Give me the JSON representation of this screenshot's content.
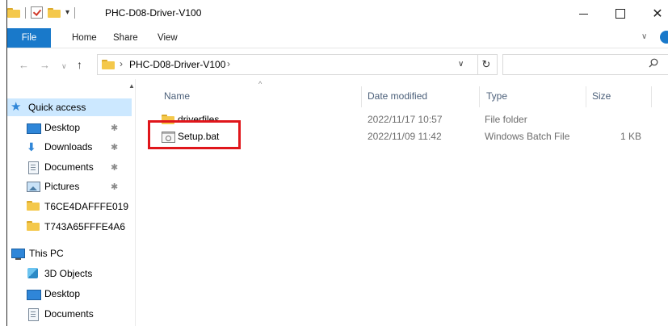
{
  "window": {
    "title": "PHC-D08-Driver-V100",
    "controls": {
      "minimize": "minimize",
      "maximize": "maximize",
      "close": "✕"
    }
  },
  "quick_access_toolbar": {
    "icons": [
      "folder-icon",
      "properties-check-icon",
      "new-folder-icon",
      "customize-dropdown-icon"
    ],
    "dropdown": "▾"
  },
  "ribbon": {
    "file": "File",
    "tabs": [
      "Home",
      "Share",
      "View"
    ],
    "expand": "∨"
  },
  "navigation": {
    "back": "←",
    "forward": "→",
    "recent": "∨",
    "up": "↑"
  },
  "address_bar": {
    "separator": "›",
    "path": [
      "PHC-D08-Driver-V100"
    ],
    "dropdown": "∨",
    "refresh": "↻"
  },
  "search": {
    "placeholder": ""
  },
  "nav_pane": {
    "scroll_up": "▲",
    "quick_access": "Quick access",
    "items": [
      {
        "label": "Desktop",
        "icon": "desktop-icon",
        "pinned": true
      },
      {
        "label": "Downloads",
        "icon": "downloads-icon",
        "pinned": true
      },
      {
        "label": "Documents",
        "icon": "documents-icon",
        "pinned": true
      },
      {
        "label": "Pictures",
        "icon": "pictures-icon",
        "pinned": true
      },
      {
        "label": "T6CE4DAFFFE019",
        "icon": "folder-icon",
        "pinned": false
      },
      {
        "label": "T743A65FFFE4A6",
        "icon": "folder-icon",
        "pinned": false
      }
    ],
    "pin_glyph": "✱",
    "this_pc": "This PC",
    "pc_items": [
      {
        "label": "3D Objects",
        "icon": "3d-objects-icon"
      },
      {
        "label": "Desktop",
        "icon": "desktop-icon"
      },
      {
        "label": "Documents",
        "icon": "documents-icon"
      }
    ]
  },
  "file_list": {
    "sort_indicator": "^",
    "columns": {
      "name": "Name",
      "date": "Date modified",
      "type": "Type",
      "size": "Size"
    },
    "rows": [
      {
        "name": "driverfiles",
        "date": "2022/11/17 10:57",
        "type": "File folder",
        "size": "",
        "icon": "folder-icon"
      },
      {
        "name": "Setup.bat",
        "date": "2022/11/09 11:42",
        "type": "Windows Batch File",
        "size": "1 KB",
        "icon": "batch-file-icon"
      }
    ]
  },
  "annotation": {
    "highlight_color": "#e0161b",
    "target": "Setup.bat"
  },
  "colors": {
    "accent": "#1979ca",
    "selection": "#cce8ff",
    "folder": "#f4c84b"
  }
}
